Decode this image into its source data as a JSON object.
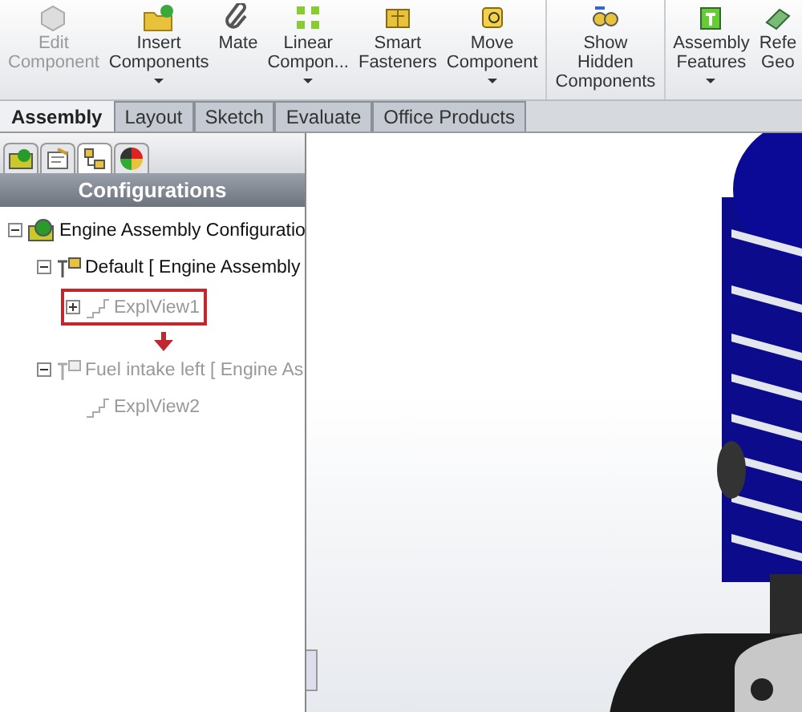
{
  "toolbar": {
    "groups": [
      [
        {
          "lines": [
            "Edit",
            "Component"
          ],
          "dropdown": false,
          "disabled": true
        },
        {
          "lines": [
            "Insert",
            "Components"
          ],
          "dropdown": true,
          "disabled": false
        },
        {
          "lines": [
            "Mate"
          ],
          "dropdown": false,
          "disabled": false
        },
        {
          "lines": [
            "Linear",
            "Compon..."
          ],
          "dropdown": true,
          "disabled": false
        },
        {
          "lines": [
            "Smart",
            "Fasteners"
          ],
          "dropdown": false,
          "disabled": false
        },
        {
          "lines": [
            "Move",
            "Component"
          ],
          "dropdown": true,
          "disabled": false
        }
      ],
      [
        {
          "lines": [
            "Show",
            "Hidden",
            "Components"
          ],
          "dropdown": false,
          "disabled": false
        }
      ],
      [
        {
          "lines": [
            "Assembly",
            "Features"
          ],
          "dropdown": true,
          "disabled": false
        },
        {
          "lines": [
            "Refe",
            "Geo"
          ],
          "dropdown": false,
          "disabled": false
        }
      ]
    ]
  },
  "tabs": [
    {
      "label": "Assembly",
      "selected": true
    },
    {
      "label": "Layout",
      "selected": false
    },
    {
      "label": "Sketch",
      "selected": false
    },
    {
      "label": "Evaluate",
      "selected": false
    },
    {
      "label": "Office Products",
      "selected": false
    }
  ],
  "panel": {
    "tabs": [
      {
        "selected": false
      },
      {
        "selected": false
      },
      {
        "selected": true
      },
      {
        "selected": false
      }
    ],
    "title": "Configurations",
    "tree": [
      {
        "kind": "assembly",
        "label": "Engine Assembly Configuratio",
        "expanded": true,
        "disabled": false,
        "highlighted": false,
        "children": [
          {
            "kind": "configuration",
            "label": "Default [ Engine Assembly",
            "expanded": true,
            "disabled": false,
            "highlighted": false,
            "children": [
              {
                "kind": "exploded-view",
                "label": "ExplView1",
                "expanded": false,
                "disabled": true,
                "highlighted": true
              }
            ]
          },
          {
            "kind": "configuration",
            "label": "Fuel intake left [ Engine As",
            "expanded": true,
            "disabled": true,
            "highlighted": false,
            "children": [
              {
                "kind": "exploded-view",
                "label": "ExplView2",
                "disabled": true,
                "highlighted": false
              }
            ]
          }
        ]
      }
    ]
  }
}
